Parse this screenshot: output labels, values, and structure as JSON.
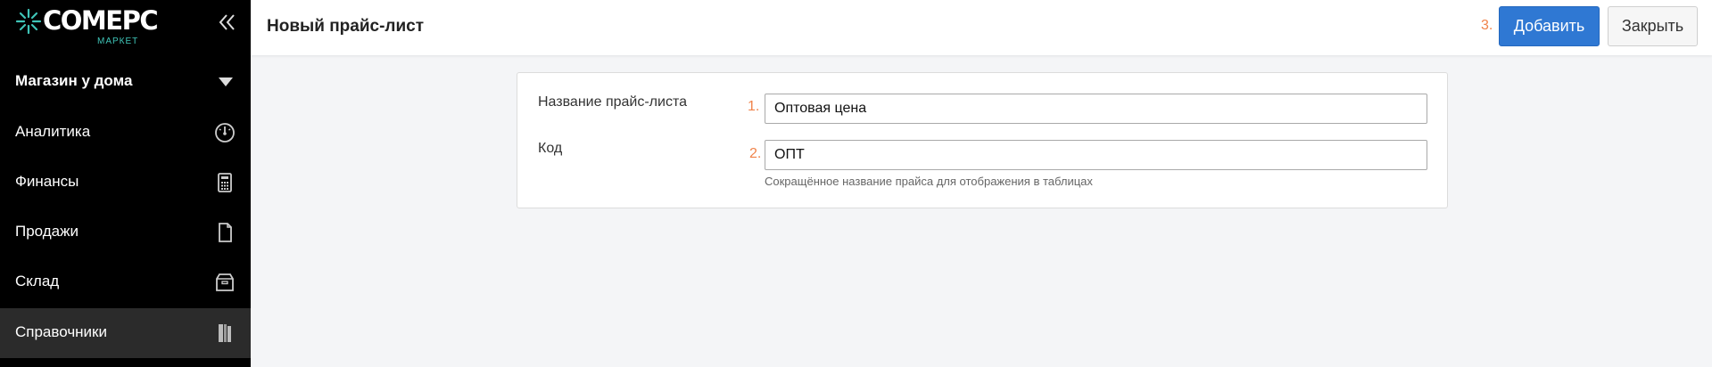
{
  "brand": {
    "name": "COMEPC",
    "sub": "МАРКЕТ",
    "accent": "#3fc5b8"
  },
  "sidebar": {
    "collapse_icon": "double-chevron-left-icon",
    "store": {
      "label": "Магазин у дома",
      "icon": "caret-down-icon"
    },
    "items": [
      {
        "label": "Аналитика",
        "icon": "gauge-icon",
        "active": false
      },
      {
        "label": "Финансы",
        "icon": "calculator-icon",
        "active": false
      },
      {
        "label": "Продажи",
        "icon": "document-icon",
        "active": false
      },
      {
        "label": "Склад",
        "icon": "box-icon",
        "active": false
      },
      {
        "label": "Справочники",
        "icon": "book-icon",
        "active": true
      }
    ]
  },
  "header": {
    "title": "Новый прайс-лист",
    "hint3": "3.",
    "add_label": "Добавить",
    "close_label": "Закрыть",
    "primary_color": "#2f78d3",
    "hint_color": "#f0834a"
  },
  "form": {
    "name": {
      "label": "Название прайс-листа",
      "hint_num": "1.",
      "value": "Оптовая цена"
    },
    "code": {
      "label": "Код",
      "hint_num": "2.",
      "value": "ОПТ",
      "help": "Сокращённое название прайса для отображения в таблицах"
    }
  }
}
